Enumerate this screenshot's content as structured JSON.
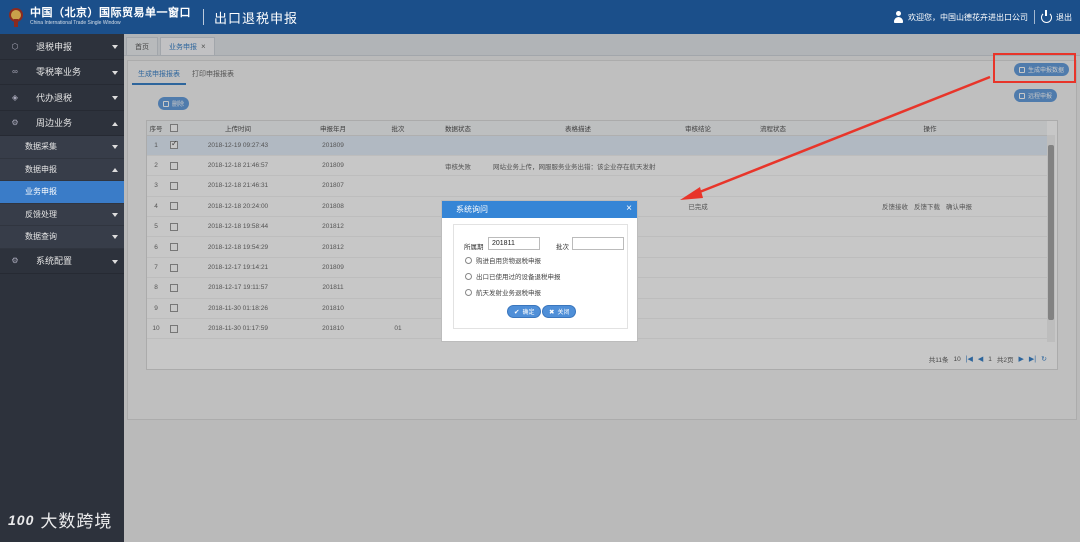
{
  "header": {
    "brand_cn": "中国（北京）国际贸易单一窗口",
    "brand_en": "China International Trade Single Window",
    "module_title": "出口退税申报",
    "welcome": "欢迎您，中国山德花卉进出口公司",
    "logout": "退出"
  },
  "sidebar": {
    "items": [
      {
        "label": "退税申报",
        "icon": "cube-icon"
      },
      {
        "label": "零税率业务",
        "icon": "link-icon"
      },
      {
        "label": "代办退税",
        "icon": "stack-icon"
      },
      {
        "label": "周边业务",
        "icon": "gear-icon"
      }
    ],
    "sub_items": [
      {
        "label": "数据采集"
      },
      {
        "label": "数据申报"
      },
      {
        "label": "业务申报"
      },
      {
        "label": "反馈处理"
      },
      {
        "label": "数据查询"
      }
    ],
    "last_item": {
      "label": "系统配置",
      "icon": "gear-icon"
    },
    "watermark": "大数跨境",
    "watermark_logo": "100"
  },
  "tabs": [
    {
      "label": "首页"
    },
    {
      "label": "业务申报",
      "close": "×"
    }
  ],
  "subtabs": [
    {
      "label": "生成申报报表"
    },
    {
      "label": "打印申报报表"
    }
  ],
  "buttons": {
    "delete": "删除",
    "generate": "生成申报数据",
    "remote": "远程申报"
  },
  "table": {
    "headers": [
      "序号",
      "",
      "上传时间",
      "申报年月",
      "批次",
      "数据状态",
      "表格描述",
      "审核结论",
      "流程状态",
      "操作"
    ],
    "rows": [
      {
        "no": "1",
        "checked": true,
        "time": "2018-12-19 09:27:43",
        "ym": "201809",
        "batch": "",
        "status": "",
        "desc": "",
        "result": "",
        "flow": "",
        "ops": [
          "",
          "",
          ""
        ]
      },
      {
        "no": "2",
        "checked": false,
        "time": "2018-12-18 21:46:57",
        "ym": "201809",
        "batch": "",
        "status": "审核失败",
        "desc": "网站业务上传，网服服务业务出错：该企业存在航天发射",
        "result": "",
        "flow": "",
        "ops": [
          "",
          "",
          ""
        ]
      },
      {
        "no": "3",
        "checked": false,
        "time": "2018-12-18 21:46:31",
        "ym": "201807",
        "batch": "",
        "status": "",
        "desc": "",
        "result": "",
        "flow": "",
        "ops": [
          "",
          "",
          ""
        ]
      },
      {
        "no": "4",
        "checked": false,
        "time": "2018-12-18 20:24:00",
        "ym": "201808",
        "batch": "",
        "status": "",
        "desc": "成。请查看反馈",
        "result": "已完成",
        "flow": "",
        "ops": [
          "反馈接收",
          "反馈下载",
          "确认申报"
        ]
      },
      {
        "no": "5",
        "checked": false,
        "time": "2018-12-18 19:58:44",
        "ym": "201812",
        "batch": "",
        "status": "",
        "desc": "企业存在航天发射",
        "result": "",
        "flow": "",
        "ops": [
          "",
          "",
          ""
        ]
      },
      {
        "no": "6",
        "checked": false,
        "time": "2018-12-18 19:54:29",
        "ym": "201812",
        "batch": "",
        "status": "",
        "desc": "服务WSIF建立",
        "result": "",
        "flow": "",
        "ops": [
          "",
          "",
          ""
        ]
      },
      {
        "no": "7",
        "checked": false,
        "time": "2018-12-17 19:14:21",
        "ym": "201809",
        "batch": "",
        "status": "",
        "desc": "013960633）&",
        "result": "",
        "flow": "",
        "ops": [
          "",
          "",
          ""
        ]
      },
      {
        "no": "8",
        "checked": false,
        "time": "2018-12-17 19:11:57",
        "ym": "201811",
        "batch": "",
        "status": "",
        "desc": "013960633）&",
        "result": "",
        "flow": "",
        "ops": [
          "",
          "",
          ""
        ]
      },
      {
        "no": "9",
        "checked": false,
        "time": "2018-11-30 01:18:26",
        "ym": "201810",
        "batch": "",
        "status": "",
        "desc": "",
        "result": "",
        "flow": "",
        "ops": [
          "",
          "",
          ""
        ]
      },
      {
        "no": "10",
        "checked": false,
        "time": "2018-11-30 01:17:59",
        "ym": "201810",
        "batch": "01",
        "status": "",
        "desc": "",
        "result": "",
        "flow": "",
        "ops": [
          "",
          "",
          ""
        ]
      }
    ]
  },
  "pager": {
    "total": "共11条",
    "page_size": "10",
    "page_input": "1",
    "total_pages": "共2页"
  },
  "dialog": {
    "title": "系统询问",
    "close": "×",
    "period_label": "所属期",
    "period_value": "201811",
    "batch_label": "批次",
    "batch_value": "",
    "options": [
      "购进自用货物退税申报",
      "出口已使用过的设备退税申报",
      "航天发射业务退税申报"
    ],
    "confirm": "确定",
    "cancel": "关闭"
  },
  "colors": {
    "header_bg": "#1b4f8a",
    "sidebar_bg": "#2d323c",
    "accent": "#3585d6",
    "annotation_red": "#e8352a"
  }
}
